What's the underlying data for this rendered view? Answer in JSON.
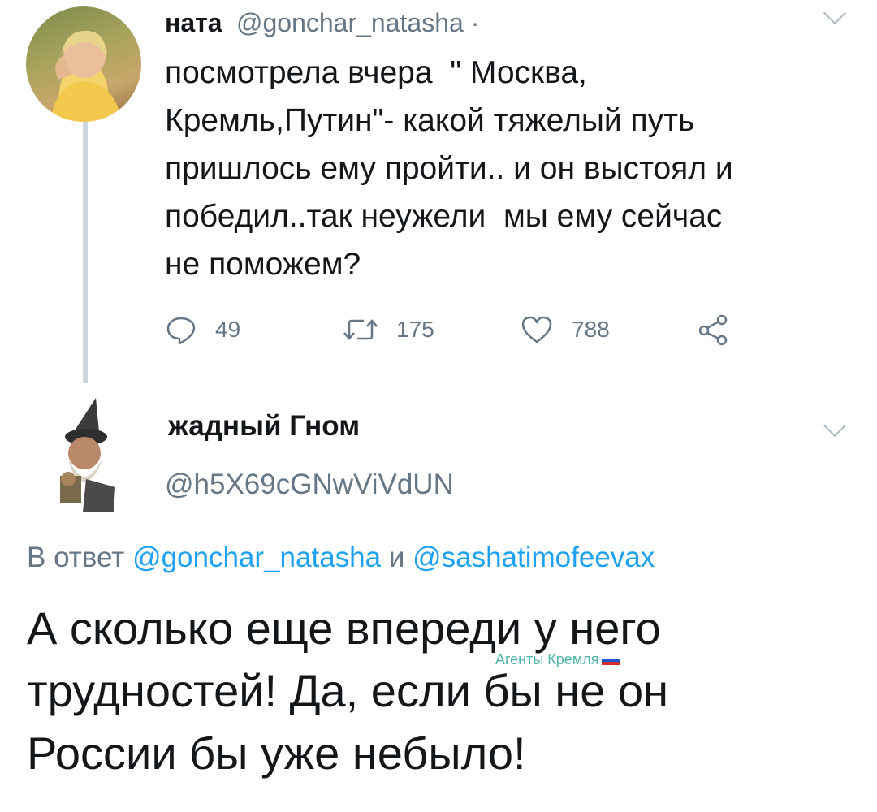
{
  "tweet1": {
    "display_name": "ната",
    "handle": "@gonchar_natasha ·",
    "text": "посмотрела вчера  \" Москва,\nКремль,Путин\"- какой тяжелый путь\nпришлось ему пройти.. и он выстоял и\nпобедил..так неужели  мы ему сейчас\nне поможем?",
    "reply_count": "49",
    "retweet_count": "175",
    "like_count": "788"
  },
  "tweet2": {
    "display_name": "жадный Гном",
    "handle": "@h5X69cGNwViVdUN",
    "reply_prefix": "В ответ ",
    "reply_user1": "@gonchar_natasha",
    "reply_conj": " и ",
    "reply_user2": "@sashatimofeevax",
    "text": "А сколько еще впереди у него\nтрудностей! Да, если бы не он\nРоссии бы уже небыло!"
  },
  "watermark": {
    "text": "Агенты Кремля"
  },
  "colors": {
    "accent": "#1da1f2",
    "secondary": "#657786",
    "thread_line": "#ccd6dd"
  },
  "icons": [
    "reply-icon",
    "retweet-icon",
    "like-icon",
    "share-icon",
    "chevron-down-icon"
  ]
}
